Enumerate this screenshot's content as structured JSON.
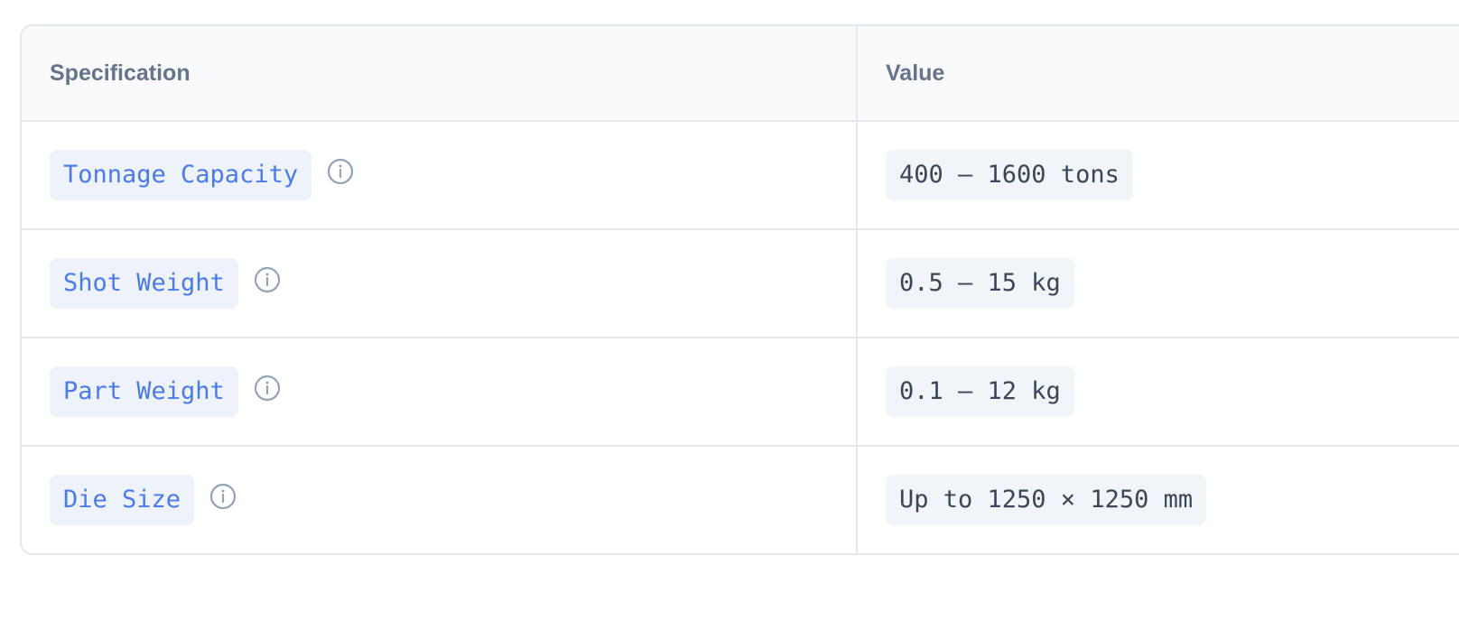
{
  "table": {
    "headers": {
      "specification": "Specification",
      "value": "Value"
    },
    "rows": [
      {
        "spec": "Tonnage Capacity",
        "value": "400 – 1600 tons",
        "info_icon": "info-icon"
      },
      {
        "spec": "Shot Weight",
        "value": "0.5 – 15 kg",
        "info_icon": "info-icon"
      },
      {
        "spec": "Part Weight",
        "value": "0.1 – 12 kg",
        "info_icon": "info-icon"
      },
      {
        "spec": "Die Size",
        "value": "Up to 1250 × 1250 mm",
        "info_icon": "info-icon"
      }
    ]
  },
  "colors": {
    "spec_text": "#4b7be8",
    "spec_bg": "#eef2fb",
    "value_text": "#3a4658",
    "value_bg": "#f1f5f9",
    "header_text": "#64748b",
    "border": "#e3e8ef",
    "icon": "#94a3b8"
  }
}
